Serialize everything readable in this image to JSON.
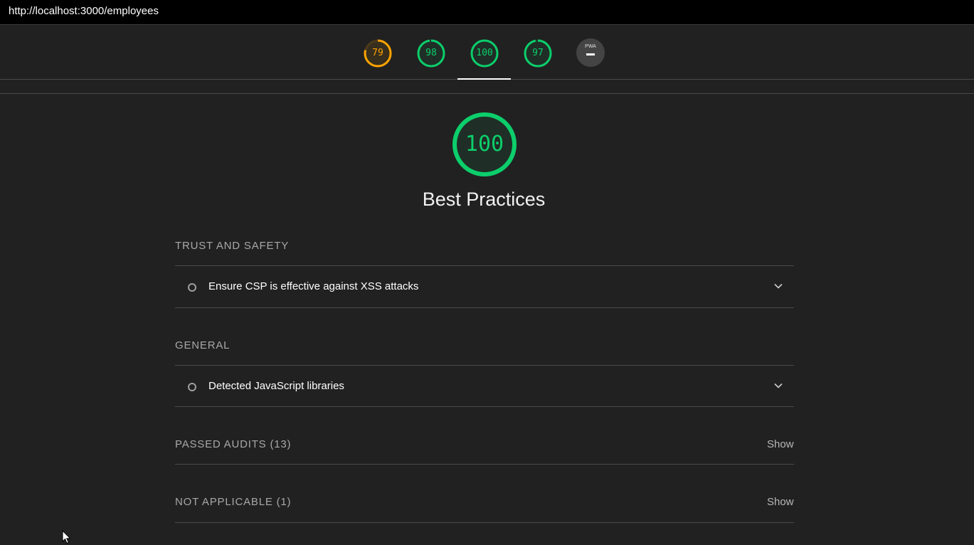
{
  "address_bar": {
    "url": "http://localhost:3000/employees"
  },
  "score_gauges": [
    {
      "score": "79",
      "color": "#ffa400"
    },
    {
      "score": "98",
      "color": "#0cce6b"
    },
    {
      "score": "100",
      "color": "#0cce6b"
    },
    {
      "score": "97",
      "color": "#0cce6b"
    }
  ],
  "pwa_badge": {
    "label": "PWA",
    "state": "not-applicable"
  },
  "category": {
    "score": "100",
    "title": "Best Practices",
    "color": "#0cce6b"
  },
  "sections": {
    "trust_and_safety": {
      "header": "TRUST AND SAFETY",
      "audits": [
        {
          "title": "Ensure CSP is effective against XSS attacks"
        }
      ]
    },
    "general": {
      "header": "GENERAL",
      "audits": [
        {
          "title": "Detected JavaScript libraries"
        }
      ]
    },
    "passed_audits": {
      "header": "PASSED AUDITS (13)",
      "action": "Show"
    },
    "not_applicable": {
      "header": "NOT APPLICABLE (1)",
      "action": "Show"
    }
  },
  "icons": {
    "audit_marker": "hollow-circle-icon",
    "expand": "chevron-down-icon",
    "cursor": "mouse-pointer-icon"
  }
}
